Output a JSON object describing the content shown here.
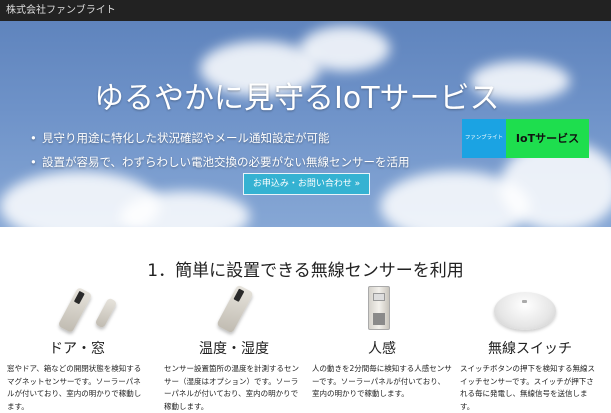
{
  "header": {
    "company": "株式会社ファンブライト"
  },
  "hero": {
    "title": "ゆるやかに見守るIoTサービス",
    "bullets": [
      "見守り用途に特化した状況確認やメール通知設定が可能",
      "設置が容易で、わずらわしい電池交換の必要がない無線センサーを活用"
    ],
    "cta_label": "お申込み・お問い合わせ »",
    "logo": {
      "left_text": "ファンブライト",
      "right_text": "IoTサービス",
      "left_color": "#1ba3e3",
      "right_color": "#1ede4e"
    }
  },
  "section": {
    "title": "1．簡単に設置できる無線センサーを利用"
  },
  "features": [
    {
      "title": "ドア・窓",
      "desc": "窓やドア、箱などの開閉状態を検知するマグネットセンサーです。ソーラーパネルが付いており、室内の明かりで稼動します。"
    },
    {
      "title": "温度・湿度",
      "desc": "センサー設置箇所の温度を計測するセンサー（湿度はオプション）です。ソーラーパネルが付いており、室内の明かりで稼動します。"
    },
    {
      "title": "人感",
      "desc": "人の動きを2分間毎に検知する人感センサーです。ソーラーパネルが付いており、室内の明かりで稼動します。"
    },
    {
      "title": "無線スイッチ",
      "desc": "スイッチボタンの押下を検知する無線スイッチセンサーです。スイッチが押下される毎に発電し、無線信号を送信します。"
    }
  ]
}
